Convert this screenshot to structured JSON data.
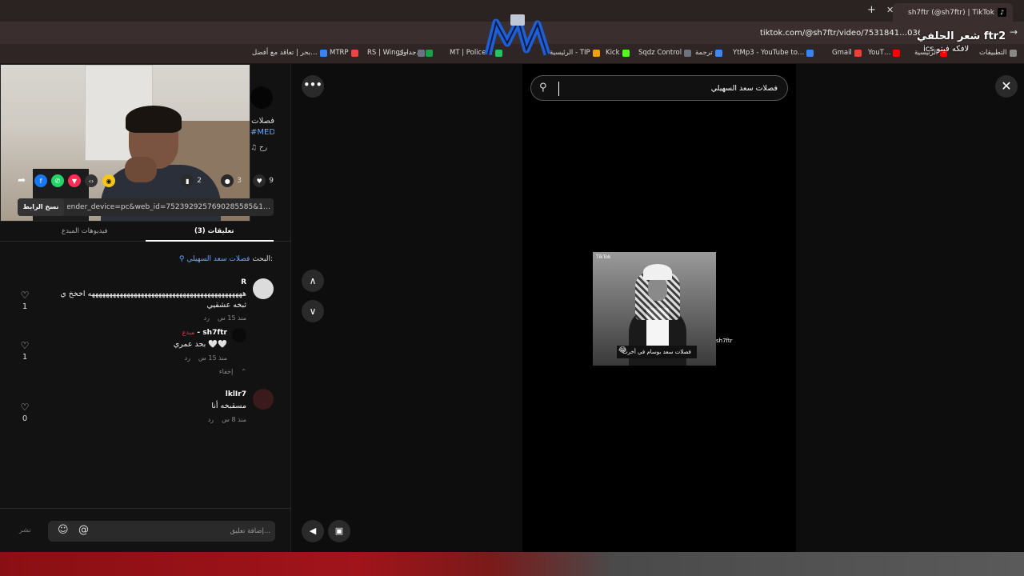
{
  "browser": {
    "tab_title": "sh7ftr (@sh7ftr) | TikTok",
    "tab_icon": "tiktok-icon",
    "url": "tiktok.com/@sh7ftr/video/7531841…0368268",
    "bookmarks": [
      {
        "label": "التطبيقات",
        "color": "#888888"
      },
      {
        "label": "الرئيسية",
        "color": "#ff0000"
      },
      {
        "label": "YouT…",
        "color": "#ff0000"
      },
      {
        "label": "Gmail",
        "color": "#ea4335"
      },
      {
        "label": "YtMp3 - YouTube to…",
        "color": "#3b82f6"
      },
      {
        "label": "ترجمة",
        "color": "#4285f4"
      },
      {
        "label": "Sqdz Control",
        "color": "#6b7280"
      },
      {
        "label": "Kick",
        "color": "#53fc18"
      },
      {
        "label": "الرئيسية - TIP",
        "color": "#f59e0b"
      },
      {
        "label": "MT | Police…",
        "color": "#22c55e"
      },
      {
        "label": "جداول…",
        "color": "#16a34a"
      },
      {
        "label": "RS | Wings -…",
        "color": "#6b7280"
      },
      {
        "label": "MTRP",
        "color": "#ef4444"
      },
      {
        "label": "بحر | تعاقد مع أفضل…",
        "color": "#3b82f6"
      }
    ]
  },
  "overlay": {
    "line1": "شعر الحلفي ftr2",
    "line2": "ics لافكه فيتو"
  },
  "profile": {
    "title": "فصلات",
    "tag": "#MED",
    "sound": "♫ رح"
  },
  "actions": {
    "likes": "9",
    "comments": "3",
    "saves": "2"
  },
  "share": {
    "copy_label": "نسخ الرابط",
    "url": "…1&sender_device=pc&web_id=7523929257690285585"
  },
  "tabs": {
    "comments": "(3) تعليقات",
    "creator_videos": "فيديوهات المبدع"
  },
  "search_context": {
    "label": "البحث:",
    "query": "فصلات سعد السهيلي"
  },
  "comments": [
    {
      "user": "R",
      "text": "ههههههههههههههههههههههههههههههههههههههههههههه اخخخ ي",
      "text2": "ثبخه عشقيي",
      "time": "منذ 15 س",
      "reply": "رد",
      "likes": "1",
      "avatar_color": "#dcdcdc"
    },
    {
      "user": "sh7ftr",
      "creator": "مبدع",
      "text": "بحد عمري 🤍🤍",
      "time": "منذ 15 س",
      "reply": "رد",
      "likes": "1",
      "avatar_color": "#0a0a0a"
    },
    {
      "user": "lklIr7",
      "text": "مسقبخه أنا",
      "time": "منذ 8 س",
      "reply": "رد",
      "likes": "0",
      "avatar_color": "#3a1a1a"
    }
  ],
  "hide_label": "إخفاء",
  "comment_bar": {
    "placeholder": "إضافة تعليق...",
    "post": "نشر"
  },
  "video": {
    "search_value": "فصلات سعد السهيلي",
    "caption": "فصلات سعد بوسام في أخرت",
    "username": "sh7ftr",
    "watermark": "TikTok"
  }
}
